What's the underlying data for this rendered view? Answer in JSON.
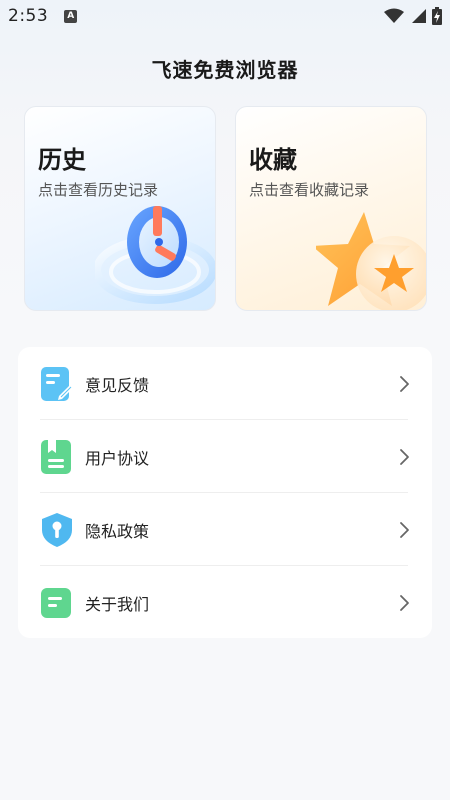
{
  "status_bar": {
    "time": "2:53",
    "notification_icon_letter": "A"
  },
  "app": {
    "title": "飞速免费浏览器"
  },
  "cards": {
    "history": {
      "title": "历史",
      "subtitle": "点击查看历史记录",
      "icon": "history-clock-icon"
    },
    "favorites": {
      "title": "收藏",
      "subtitle": "点击查看收藏记录",
      "icon": "star-icon"
    }
  },
  "menu": {
    "items": [
      {
        "label": "意见反馈",
        "icon": "feedback-edit-icon",
        "color": "#5cc3f5"
      },
      {
        "label": "用户协议",
        "icon": "document-bookmark-icon",
        "color": "#5fd68f"
      },
      {
        "label": "隐私政策",
        "icon": "shield-key-icon",
        "color": "#4fb8f0"
      },
      {
        "label": "关于我们",
        "icon": "message-lines-icon",
        "color": "#5fd68f"
      }
    ]
  },
  "colors": {
    "background": "#f7f8fa",
    "card_history_accent": "#3a7cf5",
    "card_fav_accent": "#ffa93a"
  }
}
